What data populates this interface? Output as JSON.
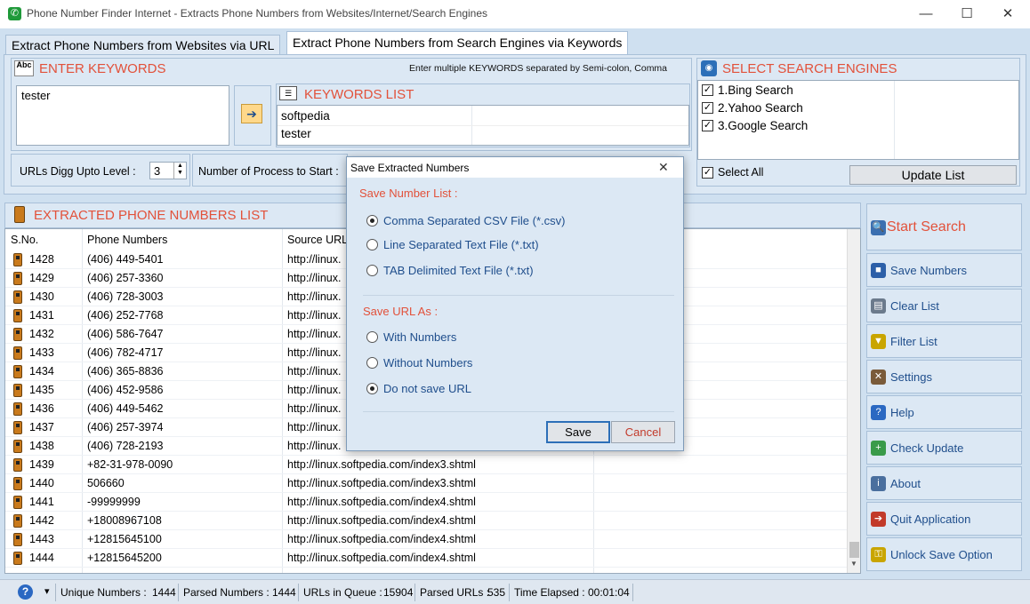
{
  "window": {
    "title": "Phone Number Finder Internet - Extracts Phone Numbers from Websites/Internet/Search Engines",
    "minimize": "—",
    "maximize": "☐",
    "close": "✕"
  },
  "tabs": [
    {
      "label": "Extract Phone Numbers from Websites via URL"
    },
    {
      "label": "Extract Phone Numbers from Search Engines via Keywords"
    }
  ],
  "keywords_panel": {
    "icon_text": "Abc",
    "title": "ENTER KEYWORDS",
    "hint": "Enter multiple KEYWORDS separated by Semi-colon, Comma",
    "input_value": "tester",
    "add_arrow": "➔"
  },
  "keywords_list": {
    "title": "KEYWORDS LIST",
    "items": [
      "softpedia",
      "tester"
    ]
  },
  "search_engines": {
    "title": "SELECT SEARCH ENGINES",
    "items": [
      {
        "label": "1.Bing Search",
        "checked": true
      },
      {
        "label": "2.Yahoo Search",
        "checked": true
      },
      {
        "label": "3.Google Search",
        "checked": true
      }
    ],
    "select_all": "Select All",
    "update_button": "Update List"
  },
  "options": {
    "digg_label": "URLs Digg Upto Level :",
    "digg_value": "3",
    "process_label": "Number of Process to Start :"
  },
  "extracted": {
    "title": "EXTRACTED PHONE NUMBERS LIST",
    "columns": [
      "S.No.",
      "Phone Numbers",
      "Source URL"
    ],
    "rows": [
      {
        "sno": "1428",
        "phone": "(406) 449-5401",
        "url": "http://linux."
      },
      {
        "sno": "1429",
        "phone": "(406) 257-3360",
        "url": "http://linux."
      },
      {
        "sno": "1430",
        "phone": "(406) 728-3003",
        "url": "http://linux."
      },
      {
        "sno": "1431",
        "phone": "(406) 252-7768",
        "url": "http://linux."
      },
      {
        "sno": "1432",
        "phone": "(406) 586-7647",
        "url": "http://linux."
      },
      {
        "sno": "1433",
        "phone": "(406) 782-4717",
        "url": "http://linux."
      },
      {
        "sno": "1434",
        "phone": "(406) 365-8836",
        "url": "http://linux."
      },
      {
        "sno": "1435",
        "phone": "(406) 452-9586",
        "url": "http://linux."
      },
      {
        "sno": "1436",
        "phone": "(406) 449-5462",
        "url": "http://linux."
      },
      {
        "sno": "1437",
        "phone": "(406) 257-3974",
        "url": "http://linux."
      },
      {
        "sno": "1438",
        "phone": "(406) 728-2193",
        "url": "http://linux."
      },
      {
        "sno": "1439",
        "phone": "+82-31-978-0090",
        "url": "http://linux.softpedia.com/index3.shtml"
      },
      {
        "sno": "1440",
        "phone": "506660",
        "url": "http://linux.softpedia.com/index3.shtml"
      },
      {
        "sno": "1441",
        "phone": "-99999999",
        "url": "http://linux.softpedia.com/index4.shtml"
      },
      {
        "sno": "1442",
        "phone": "+18008967108",
        "url": "http://linux.softpedia.com/index4.shtml"
      },
      {
        "sno": "1443",
        "phone": "+12815645100",
        "url": "http://linux.softpedia.com/index4.shtml"
      },
      {
        "sno": "1444",
        "phone": "+12815645200",
        "url": "http://linux.softpedia.com/index4.shtml"
      }
    ]
  },
  "sidebar": {
    "buttons": [
      {
        "name": "start-search",
        "label": "Start Search",
        "icon": "magnifier-icon",
        "glyph": "🔍",
        "color": "#3b6fb0"
      },
      {
        "name": "save-numbers",
        "label": "Save Numbers",
        "icon": "save-icon",
        "glyph": "■",
        "color": "#2c5fa8"
      },
      {
        "name": "clear-list",
        "label": "Clear List",
        "icon": "clear-icon",
        "glyph": "▤",
        "color": "#6b7a8c"
      },
      {
        "name": "filter-list",
        "label": "Filter List",
        "icon": "filter-icon",
        "glyph": "▼",
        "color": "#c9a500"
      },
      {
        "name": "settings",
        "label": "Settings",
        "icon": "tools-icon",
        "glyph": "✕",
        "color": "#7a5b3a"
      },
      {
        "name": "help",
        "label": "Help",
        "icon": "help-icon",
        "glyph": "?",
        "color": "#2a68c2"
      },
      {
        "name": "check-update",
        "label": "Check Update",
        "icon": "update-icon",
        "glyph": "+",
        "color": "#3a9b4a"
      },
      {
        "name": "about",
        "label": "About",
        "icon": "about-icon",
        "glyph": "i",
        "color": "#4a6f9e"
      },
      {
        "name": "quit-application",
        "label": "Quit Application",
        "icon": "exit-icon",
        "glyph": "➔",
        "color": "#c23a2a"
      },
      {
        "name": "unlock-save-option",
        "label": "Unlock Save Option",
        "icon": "key-icon",
        "glyph": "⚿",
        "color": "#c9a500"
      }
    ]
  },
  "dialog": {
    "title": "Save Extracted Numbers",
    "close": "✕",
    "number_list_title": "Save Number List :",
    "number_options": [
      {
        "label": "Comma Separated CSV File (*.csv)",
        "selected": true
      },
      {
        "label": "Line Separated Text File (*.txt)",
        "selected": false
      },
      {
        "label": "TAB Delimited Text File (*.txt)",
        "selected": false
      }
    ],
    "url_title": "Save URL As  :",
    "url_options": [
      {
        "label": "With Numbers",
        "selected": false
      },
      {
        "label": "Without Numbers",
        "selected": false
      },
      {
        "label": "Do not save URL",
        "selected": true
      }
    ],
    "save_button": "Save",
    "cancel_button": "Cancel"
  },
  "statusbar": {
    "help_glyph": "?",
    "dropdown_glyph": "▾",
    "unique_label": "Unique Numbers :",
    "unique_value": "1444",
    "parsed_numbers_label": "Parsed Numbers :",
    "parsed_numbers_value": "1444",
    "queue_label": "URLs in Queue :",
    "queue_value": "15904",
    "parsed_urls_label": "Parsed URLs :",
    "parsed_urls_value": "535",
    "elapsed_label": "Time Elapsed :",
    "elapsed_value": "00:01:04"
  },
  "colors": {
    "accent_title": "#e2513a",
    "link_blue": "#1f4e8c",
    "panel": "#dce8f4",
    "background": "#cfe0f0"
  }
}
